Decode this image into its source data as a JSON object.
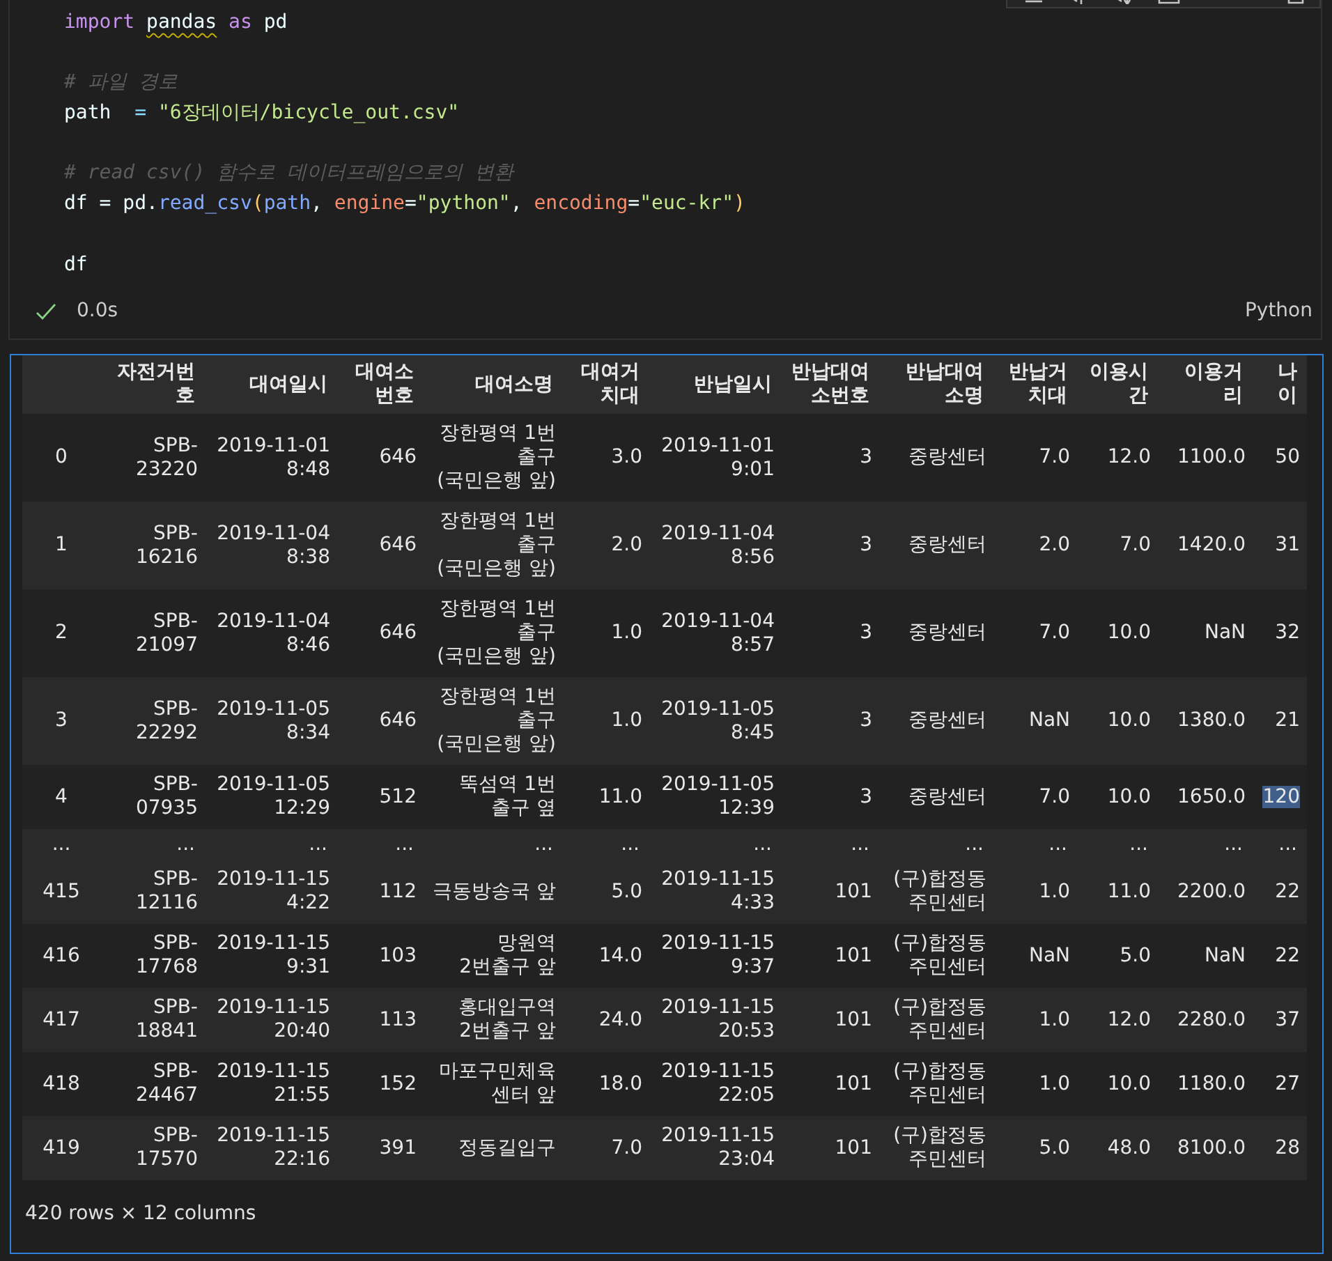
{
  "code_cell": {
    "code_blocks": [
      [
        [
          {
            "text": "import ",
            "kind": "keyword"
          },
          {
            "text": "pandas",
            "kind": "warned"
          },
          {
            "text": " as",
            "kind": "keyword"
          },
          {
            "text": " pd",
            "kind": "name"
          }
        ]
      ],
      [
        [
          {
            "text": "# 파일 경로",
            "kind": "comment"
          }
        ],
        [
          {
            "text": "path  ",
            "kind": "name"
          },
          {
            "text": "= ",
            "kind": "op"
          },
          {
            "text": "\"6장데이터/bicycle_out.csv\"",
            "kind": "string"
          }
        ]
      ],
      [
        [
          {
            "text": "# read csv() 함수로 데이터프레임으로의 변환",
            "kind": "comment"
          }
        ],
        [
          {
            "text": "df ",
            "kind": "name"
          },
          {
            "text": "= ",
            "kind": "name"
          },
          {
            "text": "pd.",
            "kind": "name"
          },
          {
            "text": "read_csv",
            "kind": "func"
          },
          {
            "text": "(",
            "kind": "paren"
          },
          {
            "text": "path",
            "kind": "arg"
          },
          {
            "text": ", ",
            "kind": "name"
          },
          {
            "text": "engine",
            "kind": "param"
          },
          {
            "text": "=",
            "kind": "name"
          },
          {
            "text": "\"python\"",
            "kind": "string"
          },
          {
            "text": ", ",
            "kind": "name"
          },
          {
            "text": "encoding",
            "kind": "param"
          },
          {
            "text": "=",
            "kind": "name"
          },
          {
            "text": "\"euc-kr\"",
            "kind": "string"
          },
          {
            "text": ")",
            "kind": "paren"
          }
        ]
      ],
      [
        [
          {
            "text": "df",
            "kind": "name"
          }
        ]
      ]
    ],
    "status": {
      "ok": true,
      "time": "0.0s",
      "language": "Python"
    }
  },
  "output": {
    "focused": true,
    "table": {
      "columns": [
        "",
        "자전거번호",
        "대여일시",
        "대여소번호",
        "대여소명",
        "대여거치대",
        "반납일시",
        "반납대여소번호",
        "반납대여소명",
        "반납거치대",
        "이용시간",
        "이용거리",
        "나이"
      ],
      "rows": [
        {
          "kind": "data",
          "cells": [
            "0",
            "SPB-23220",
            "2019-11-01 8:48",
            "646",
            "장한평역 1번 출구 (국민은행 앞)",
            "3.0",
            "2019-11-01 9:01",
            "3",
            "중랑센터",
            "7.0",
            "12.0",
            "1100.0",
            "50"
          ]
        },
        {
          "kind": "data",
          "cells": [
            "1",
            "SPB-16216",
            "2019-11-04 8:38",
            "646",
            "장한평역 1번 출구 (국민은행 앞)",
            "2.0",
            "2019-11-04 8:56",
            "3",
            "중랑센터",
            "2.0",
            "7.0",
            "1420.0",
            "31"
          ]
        },
        {
          "kind": "data",
          "cells": [
            "2",
            "SPB-21097",
            "2019-11-04 8:46",
            "646",
            "장한평역 1번 출구 (국민은행 앞)",
            "1.0",
            "2019-11-04 8:57",
            "3",
            "중랑센터",
            "7.0",
            "10.0",
            "NaN",
            "32"
          ]
        },
        {
          "kind": "data",
          "cells": [
            "3",
            "SPB-22292",
            "2019-11-05 8:34",
            "646",
            "장한평역 1번 출구 (국민은행 앞)",
            "1.0",
            "2019-11-05 8:45",
            "3",
            "중랑센터",
            "NaN",
            "10.0",
            "1380.0",
            "21"
          ]
        },
        {
          "kind": "data",
          "cells": [
            "4",
            "SPB-07935",
            "2019-11-05 12:29",
            "512",
            "뚝섬역 1번 출구 옆",
            "11.0",
            "2019-11-05 12:39",
            "3",
            "중랑센터",
            "7.0",
            "10.0",
            "1650.0",
            {
              "text": "120",
              "highlighted": true
            }
          ]
        },
        {
          "kind": "ellipsis",
          "cells": [
            "...",
            "...",
            "...",
            "...",
            "...",
            "...",
            "...",
            "...",
            "...",
            "...",
            "...",
            "...",
            "..."
          ]
        },
        {
          "kind": "data",
          "cells": [
            "415",
            "SPB-12116",
            "2019-11-15 4:22",
            "112",
            "극동방송국 앞",
            "5.0",
            "2019-11-15 4:33",
            "101",
            "(구)합정동 주민센터",
            "1.0",
            "11.0",
            "2200.0",
            "22"
          ]
        },
        {
          "kind": "data",
          "cells": [
            "416",
            "SPB-17768",
            "2019-11-15 9:31",
            "103",
            "망원역 2번출구 앞",
            "14.0",
            "2019-11-15 9:37",
            "101",
            "(구)합정동 주민센터",
            "NaN",
            "5.0",
            "NaN",
            "22"
          ]
        },
        {
          "kind": "data",
          "cells": [
            "417",
            "SPB-18841",
            "2019-11-15 20:40",
            "113",
            "홍대입구역 2번출구 앞",
            "24.0",
            "2019-11-15 20:53",
            "101",
            "(구)합정동 주민센터",
            "1.0",
            "12.0",
            "2280.0",
            "37"
          ]
        },
        {
          "kind": "data",
          "cells": [
            "418",
            "SPB-24467",
            "2019-11-15 21:55",
            "152",
            "마포구민체육센터 앞",
            "18.0",
            "2019-11-15 22:05",
            "101",
            "(구)합정동 주민센터",
            "1.0",
            "10.0",
            "1180.0",
            "27"
          ]
        },
        {
          "kind": "data",
          "cells": [
            "419",
            "SPB-17570",
            "2019-11-15 22:16",
            "391",
            "정동길입구",
            "7.0",
            "2019-11-15 23:04",
            "101",
            "(구)합정동 주민센터",
            "5.0",
            "48.0",
            "8100.0",
            "28"
          ]
        }
      ]
    },
    "summary": "420 rows × 12 columns"
  }
}
